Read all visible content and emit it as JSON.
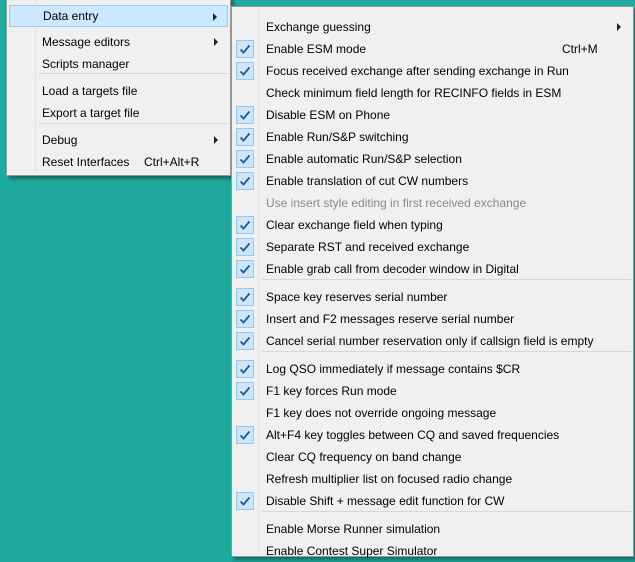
{
  "left_menu": {
    "items": [
      {
        "label": "Data entry",
        "submenu": true
      },
      {
        "label": "Message editors",
        "submenu": true
      },
      {
        "label": "Scripts manager"
      },
      {
        "label": "Load a targets file"
      },
      {
        "label": "Export a target file"
      },
      {
        "label": "Debug",
        "submenu": true
      },
      {
        "label": "Reset Interfaces",
        "shortcut": "Ctrl+Alt+R"
      }
    ]
  },
  "right_menu": {
    "items": [
      {
        "label": "Exchange guessing",
        "checked": false,
        "submenu": true
      },
      {
        "label": "Enable ESM mode",
        "checked": true,
        "shortcut": "Ctrl+M"
      },
      {
        "label": "Focus received exchange after sending exchange in Run",
        "checked": true
      },
      {
        "label": "Check minimum field length for RECINFO fields in ESM",
        "checked": false
      },
      {
        "label": "Disable ESM on Phone",
        "checked": true
      },
      {
        "label": "Enable Run/S&P switching",
        "checked": true
      },
      {
        "label": "Enable automatic Run/S&P selection",
        "checked": true
      },
      {
        "label": "Enable translation of cut CW numbers",
        "checked": true
      },
      {
        "label": "Use insert style editing in first received exchange",
        "checked": false,
        "disabled": true
      },
      {
        "label": "Clear exchange field when typing",
        "checked": true
      },
      {
        "label": "Separate RST and received exchange",
        "checked": true
      },
      {
        "label": "Enable grab call from decoder window in Digital",
        "checked": true
      },
      {
        "label": "Space key reserves serial number",
        "checked": true
      },
      {
        "label": "Insert and F2 messages reserve serial number",
        "checked": true
      },
      {
        "label": "Cancel serial number reservation only if callsign field is empty",
        "checked": true
      },
      {
        "label": "Log QSO immediately if message contains $CR",
        "checked": true
      },
      {
        "label": "F1 key forces Run mode",
        "checked": true
      },
      {
        "label": "F1 key does not override ongoing message",
        "checked": false
      },
      {
        "label": "Alt+F4 key toggles between CQ and saved frequencies",
        "checked": true
      },
      {
        "label": "Clear CQ frequency on band change",
        "checked": false
      },
      {
        "label": "Refresh multiplier list on focused radio change",
        "checked": false
      },
      {
        "label": "Disable Shift + message edit function for CW",
        "checked": true
      },
      {
        "label": "Enable Morse Runner simulation",
        "checked": false
      },
      {
        "label": "Enable Contest Super Simulator",
        "checked": false
      }
    ]
  },
  "colors": {
    "desktop": "#1fa89c",
    "menu_bg": "#f0f0f0",
    "highlight": "#cce8ff",
    "check_bg": "#cde6f7",
    "check_mark": "#1f5c99"
  },
  "icons": {
    "check": "checkmark-icon",
    "submenu": "chevron-right-icon"
  }
}
